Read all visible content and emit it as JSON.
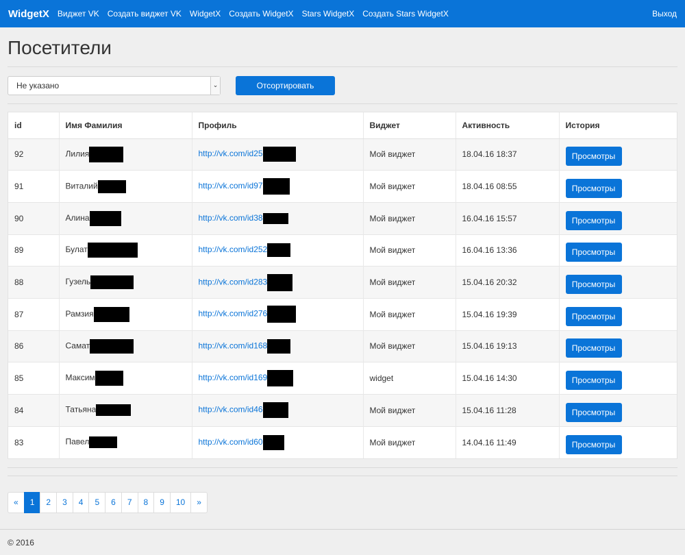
{
  "navbar": {
    "brand": "WidgetX",
    "links": [
      "Виджет VK",
      "Создать виджет VK",
      "WidgetX",
      "Создать WidgetX",
      "Stars WidgetX",
      "Создать Stars WidgetX"
    ],
    "logout": "Выход"
  },
  "page_title": "Посетители",
  "filter": {
    "selected": "Не указано",
    "sort_button": "Отсортировать"
  },
  "table": {
    "headers": [
      "id",
      "Имя Фамилия",
      "Профиль",
      "Виджет",
      "Активность",
      "История"
    ],
    "rows": [
      {
        "id": "92",
        "name": "Лилия",
        "profile": "http://vk.com/id25",
        "widget": "Мой виджет",
        "activity": "18.04.16 18:37",
        "action": "Просмотры"
      },
      {
        "id": "91",
        "name": "Виталий",
        "profile": "http://vk.com/id97",
        "widget": "Мой виджет",
        "activity": "18.04.16 08:55",
        "action": "Просмотры"
      },
      {
        "id": "90",
        "name": "Алина",
        "profile": "http://vk.com/id38",
        "widget": "Мой виджет",
        "activity": "16.04.16 15:57",
        "action": "Просмотры"
      },
      {
        "id": "89",
        "name": "Булат",
        "profile": "http://vk.com/id252",
        "widget": "Мой виджет",
        "activity": "16.04.16 13:36",
        "action": "Просмотры"
      },
      {
        "id": "88",
        "name": "Гузель",
        "profile": "http://vk.com/id283",
        "widget": "Мой виджет",
        "activity": "15.04.16 20:32",
        "action": "Просмотры"
      },
      {
        "id": "87",
        "name": "Рамзия",
        "profile": "http://vk.com/id276",
        "widget": "Мой виджет",
        "activity": "15.04.16 19:39",
        "action": "Просмотры"
      },
      {
        "id": "86",
        "name": "Самат",
        "profile": "http://vk.com/id168",
        "widget": "Мой виджет",
        "activity": "15.04.16 19:13",
        "action": "Просмотры"
      },
      {
        "id": "85",
        "name": "Максим",
        "profile": "http://vk.com/id169",
        "widget": "widget",
        "activity": "15.04.16 14:30",
        "action": "Просмотры"
      },
      {
        "id": "84",
        "name": "Татьяна",
        "profile": "http://vk.com/id46",
        "widget": "Мой виджет",
        "activity": "15.04.16 11:28",
        "action": "Просмотры"
      },
      {
        "id": "83",
        "name": "Павел",
        "profile": "http://vk.com/id60",
        "widget": "Мой виджет",
        "activity": "14.04.16 11:49",
        "action": "Просмотры"
      }
    ]
  },
  "pagination": {
    "prev": "«",
    "pages": [
      "1",
      "2",
      "3",
      "4",
      "5",
      "6",
      "7",
      "8",
      "9",
      "10"
    ],
    "next": "»",
    "active": "1"
  },
  "footer": "© 2016",
  "colors": {
    "primary": "#0a74d8",
    "background": "#efefef"
  }
}
